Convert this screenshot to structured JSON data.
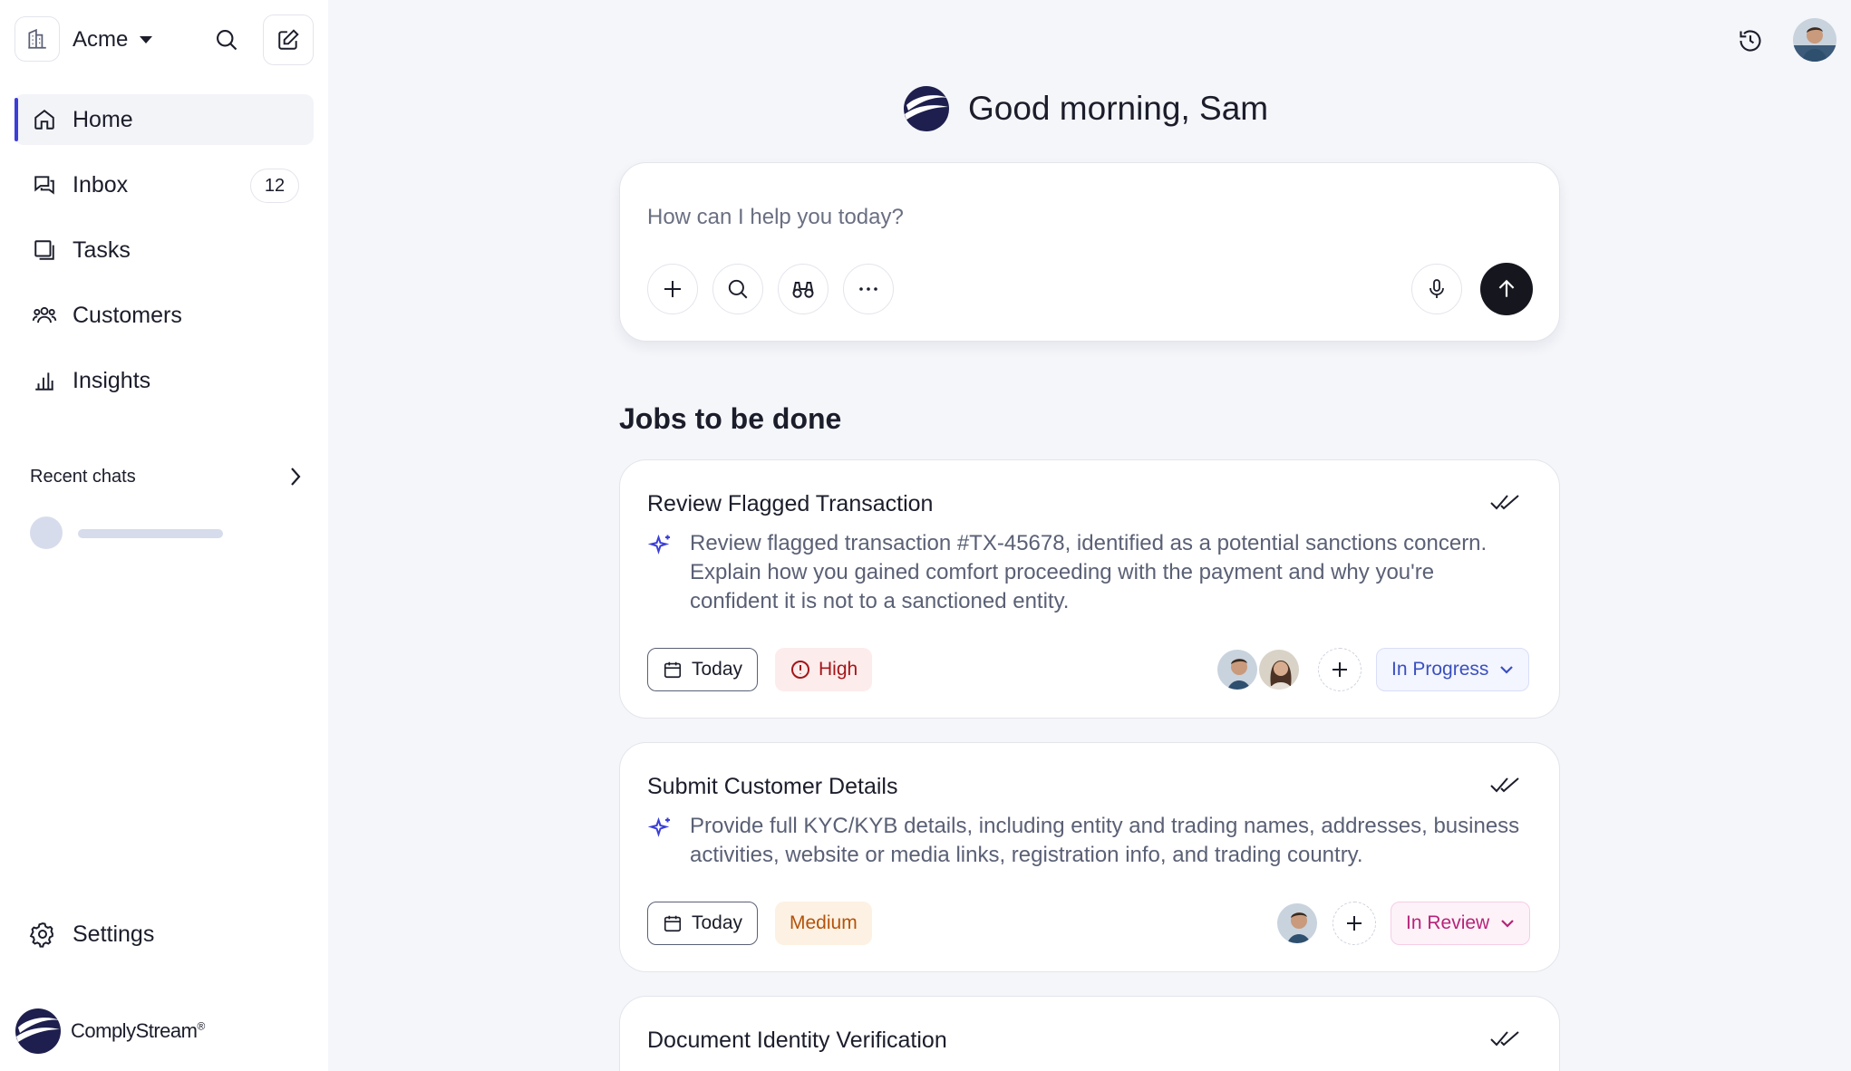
{
  "sidebar": {
    "workspace": "Acme",
    "nav": [
      {
        "label": "Home",
        "icon": "home-icon"
      },
      {
        "label": "Inbox",
        "icon": "inbox-icon",
        "badge": "12"
      },
      {
        "label": "Tasks",
        "icon": "tasks-icon"
      },
      {
        "label": "Customers",
        "icon": "customers-icon"
      },
      {
        "label": "Insights",
        "icon": "insights-icon"
      }
    ],
    "recent_chats_label": "Recent chats",
    "settings_label": "Settings",
    "brand_name": "ComplyStream",
    "brand_mark": "®"
  },
  "header": {
    "greeting": "Good morning, Sam"
  },
  "prompt": {
    "placeholder": "How can I help you today?",
    "tools": [
      "plus-icon",
      "search-icon",
      "binoculars-icon",
      "more-icon"
    ],
    "actions": [
      "microphone-icon",
      "send-arrow-icon"
    ]
  },
  "jobs": {
    "title": "Jobs to be done",
    "items": [
      {
        "title": "Review Flagged Transaction",
        "description": "Review flagged transaction #TX-45678, identified as a potential sanctions concern. Explain how you gained comfort proceeding with the payment and why you're confident it is not to a sanctioned entity.",
        "due": "Today",
        "priority": "High",
        "status": "In Progress"
      },
      {
        "title": "Submit Customer Details",
        "description": "Provide full KYC/KYB details, including entity and trading names, addresses, business activities, website or media links, registration info, and trading country.",
        "due": "Today",
        "priority": "Medium",
        "status": "In Review"
      },
      {
        "title": "Document Identity Verification"
      }
    ]
  },
  "colors": {
    "accent": "#3b3fd8",
    "high": "#a3161a",
    "medium": "#b4530a",
    "in_progress": "#3a4fc0",
    "in_review": "#b6237a"
  }
}
